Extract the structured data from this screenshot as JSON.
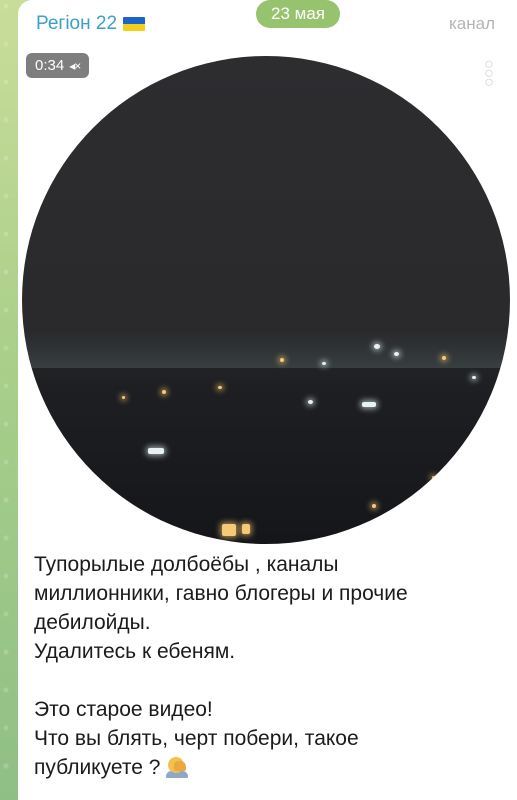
{
  "header": {
    "channel_name": "Регіон 22",
    "flag": "ukraine-flag-icon",
    "date": "23 мая",
    "channel_tag": "канал"
  },
  "video": {
    "duration": "0:34",
    "muted_icon": "speaker-muted-icon",
    "shape": "circle"
  },
  "caption": {
    "line1": "Тупорылые долбоёбы , каналы",
    "line2": "миллионники, гавно блогеры и прочие",
    "line3": "дебилойды.",
    "line4": "Удалитесь к ебеням.",
    "line5": "Это старое видео!",
    "line6": "Что вы блять, черт побери, такое",
    "line7": "публикуете ?",
    "emoji": "facepalm-icon"
  },
  "colors": {
    "channel_name": "#3aa0c9",
    "date_pill": "#95c36e",
    "bubble": "#ffffff",
    "wallpaper": "#a9cf8a"
  }
}
